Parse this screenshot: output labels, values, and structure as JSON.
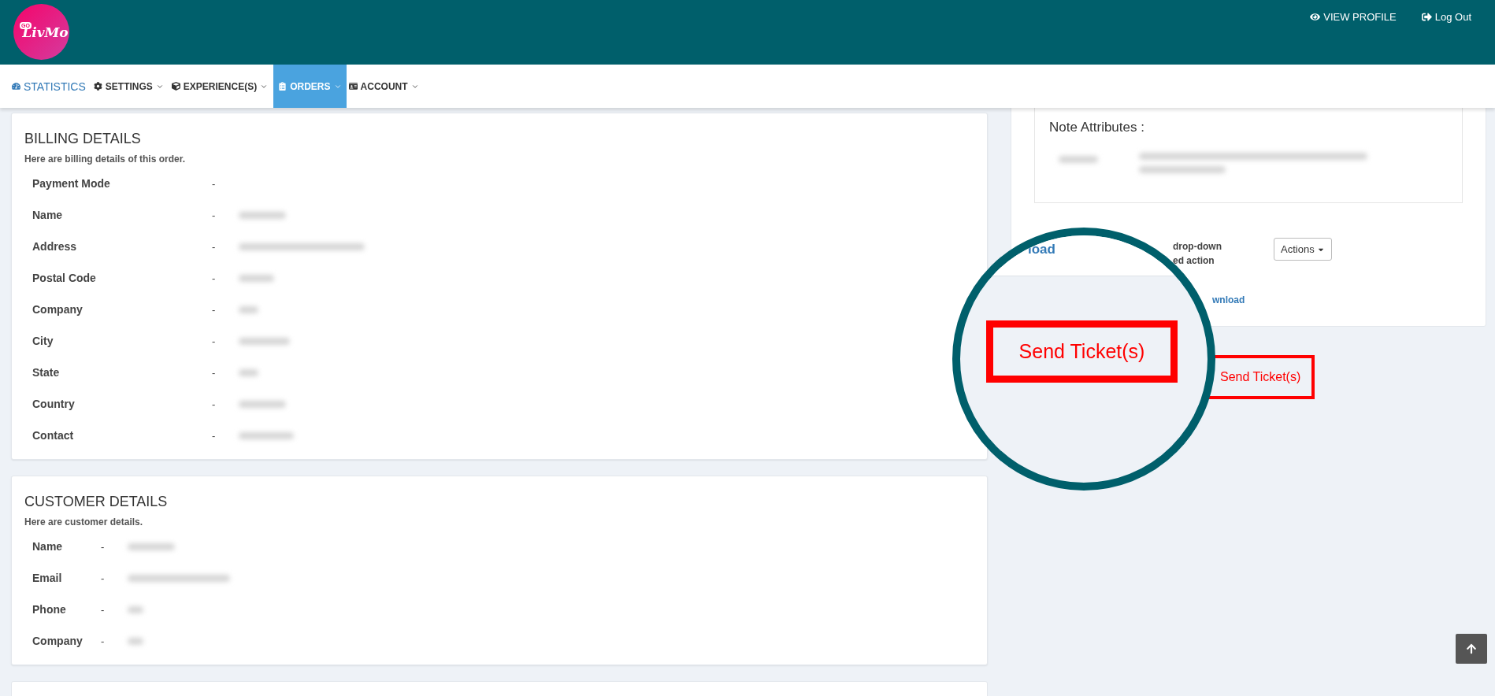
{
  "header": {
    "logo": {
      "badge": "GO",
      "text": "LivMo"
    },
    "links": [
      {
        "kind": "profile",
        "label": "VIEW PROFILE"
      },
      {
        "kind": "logout",
        "label": "Log Out"
      }
    ]
  },
  "nav": [
    {
      "kind": "link",
      "label": "STATISTICS",
      "selected": false
    },
    {
      "kind": "dropdown",
      "label": "SETTINGS",
      "selected": false
    },
    {
      "kind": "dropdown",
      "label": "EXPERIENCE(S)",
      "selected": false
    },
    {
      "kind": "dropdown",
      "label": "ORDERS",
      "selected": true
    },
    {
      "kind": "dropdown",
      "label": "ACCOUNT",
      "selected": false
    }
  ],
  "billing": {
    "title": "BILLING DETAILS",
    "subtitle": "Here are billing details of this order.",
    "rows": [
      {
        "label": "Payment Mode",
        "separator": "-",
        "redacted": false
      },
      {
        "label": "Name",
        "separator": "-",
        "redacted": true
      },
      {
        "label": "Address",
        "separator": "-",
        "redacted": true
      },
      {
        "label": "Postal Code",
        "separator": "-",
        "redacted": true
      },
      {
        "label": "Company",
        "separator": "-",
        "redacted": true
      },
      {
        "label": "City",
        "separator": "-",
        "redacted": true
      },
      {
        "label": "State",
        "separator": "-",
        "redacted": true
      },
      {
        "label": "Country",
        "separator": "-",
        "redacted": true
      },
      {
        "label": "Contact",
        "separator": "-",
        "redacted": true
      }
    ]
  },
  "customer": {
    "title": "CUSTOMER DETAILS",
    "subtitle": "Here are customer details.",
    "rows": [
      {
        "label": "Name",
        "separator": "-",
        "redacted": true
      },
      {
        "label": "Email",
        "separator": "-",
        "redacted": true
      },
      {
        "label": "Phone",
        "separator": "-",
        "redacted": true
      },
      {
        "label": "Company",
        "separator": "-",
        "redacted": true
      }
    ]
  },
  "order_panel": {
    "note_title": "Note Attributes :",
    "instruction_lines": [
      "drop-down",
      "ed action"
    ],
    "actions_button": "Actions",
    "download_link": "wnload",
    "send_ticket_button": "Send Ticket(s)"
  },
  "magnifier": {
    "heading": "load",
    "button": "Send Ticket(s)"
  }
}
